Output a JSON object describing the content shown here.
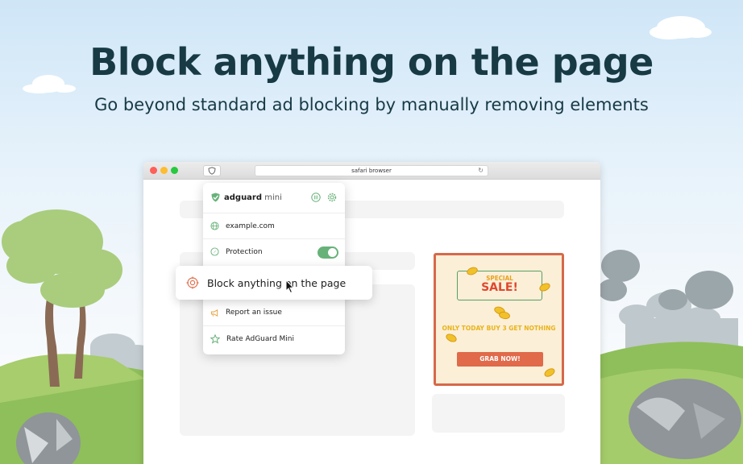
{
  "hero": {
    "title": "Block anything on the page",
    "subtitle": "Go beyond standard ad blocking by manually removing elements"
  },
  "browser": {
    "address": "safari browser"
  },
  "popup": {
    "brand": "adguard",
    "brand_suffix": " mini",
    "site": "example.com",
    "protection_label": "Protection",
    "protection_enabled": true,
    "block_label": "Block anything on the page",
    "report_label": "Report an issue",
    "rate_label": "Rate AdGuard Mini"
  },
  "ad": {
    "special": "SPECIAL",
    "sale": "SALE!",
    "tagline": "ONLY TODAY BUY 3 GET NOTHING",
    "button": "GRAB NOW!"
  },
  "colors": {
    "heading": "#173a45",
    "accent_green": "#67b279",
    "ad_border": "#d6694a",
    "ad_button": "#e06a4a"
  },
  "icons": [
    "shield-icon",
    "pause-icon",
    "gear-icon",
    "globe-icon",
    "compass-icon",
    "target-icon",
    "megaphone-icon",
    "star-icon",
    "reload-icon",
    "cursor-icon"
  ]
}
